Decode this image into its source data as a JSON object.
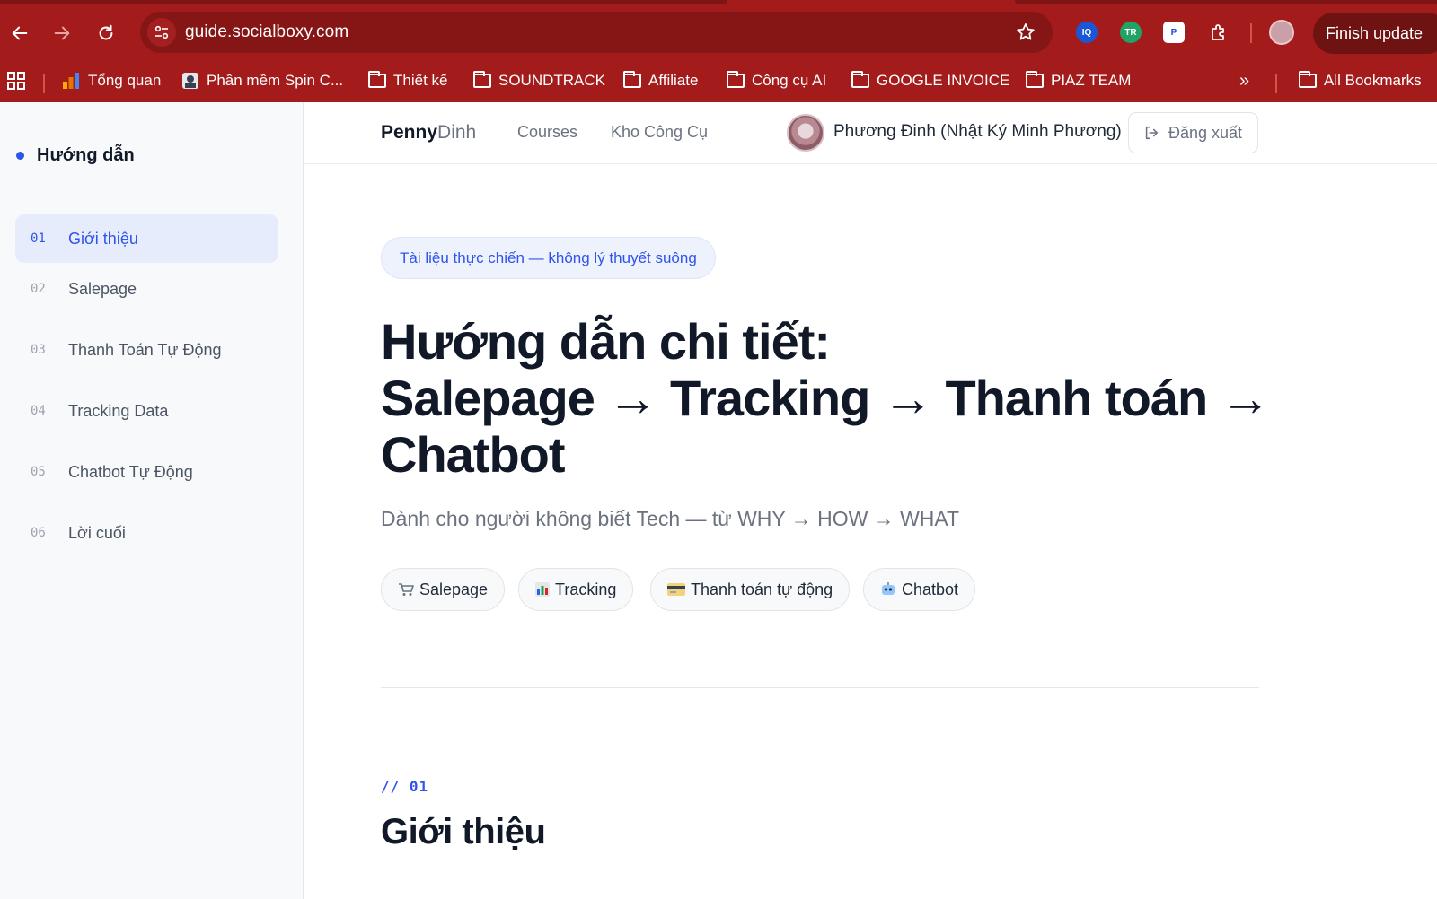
{
  "browser": {
    "url": "guide.socialboxy.com",
    "finish_update_label": "Finish update",
    "bookmarks": [
      {
        "label": "Tổng quan",
        "icon": "analytics-icon"
      },
      {
        "label": "Phần mềm Spin C...",
        "icon": "spin-icon"
      },
      {
        "label": "Thiết kế",
        "icon": "folder-icon"
      },
      {
        "label": "SOUNDTRACK",
        "icon": "folder-icon"
      },
      {
        "label": "Affiliate",
        "icon": "folder-icon"
      },
      {
        "label": "Công cụ AI",
        "icon": "folder-icon"
      },
      {
        "label": "GOOGLE INVOICE",
        "icon": "folder-icon"
      },
      {
        "label": "PIAZ TEAM",
        "icon": "folder-icon"
      }
    ],
    "more_label": "»",
    "all_bookmarks_label": "All Bookmarks",
    "accent": "#a31b1b"
  },
  "sidebar": {
    "title": "Hướng dẫn",
    "items": [
      {
        "num": "01",
        "label": "Giới thiệu",
        "active": true
      },
      {
        "num": "02",
        "label": "Salepage"
      },
      {
        "num": "03",
        "label": "Thanh Toán Tự Động"
      },
      {
        "num": "04",
        "label": "Tracking Data"
      },
      {
        "num": "05",
        "label": "Chatbot Tự Động"
      },
      {
        "num": "06",
        "label": "Lời cuối"
      }
    ]
  },
  "topnav": {
    "logo_bold": "Penny",
    "logo_light": "Dinh",
    "links": [
      "Courses",
      "Kho Công Cụ"
    ],
    "user_name": "Phương Đinh (Nhật Ký Minh Phương)",
    "logout_label": "Đăng xuất"
  },
  "hero": {
    "tag": "Tài liệu thực chiến — không lý thuyết suông",
    "title_line1": "Hướng dẫn chi tiết:",
    "title_line2": "Salepage → Tracking → Thanh toán →",
    "title_line3": "Chatbot",
    "subtitle": "Dành cho người không biết Tech — từ WHY → HOW → WHAT",
    "chips": [
      {
        "label": "Salepage",
        "icon": "cart-icon"
      },
      {
        "label": "Tracking",
        "icon": "bar-chart-icon"
      },
      {
        "label": "Thanh toán tự động",
        "icon": "card-icon"
      },
      {
        "label": "Chatbot",
        "icon": "robot-icon"
      }
    ]
  },
  "section": {
    "num": "// 01",
    "title": "Giới thiệu"
  },
  "colors": {
    "accent": "#2f54eb",
    "text": "#111827",
    "muted": "#6b7280"
  }
}
